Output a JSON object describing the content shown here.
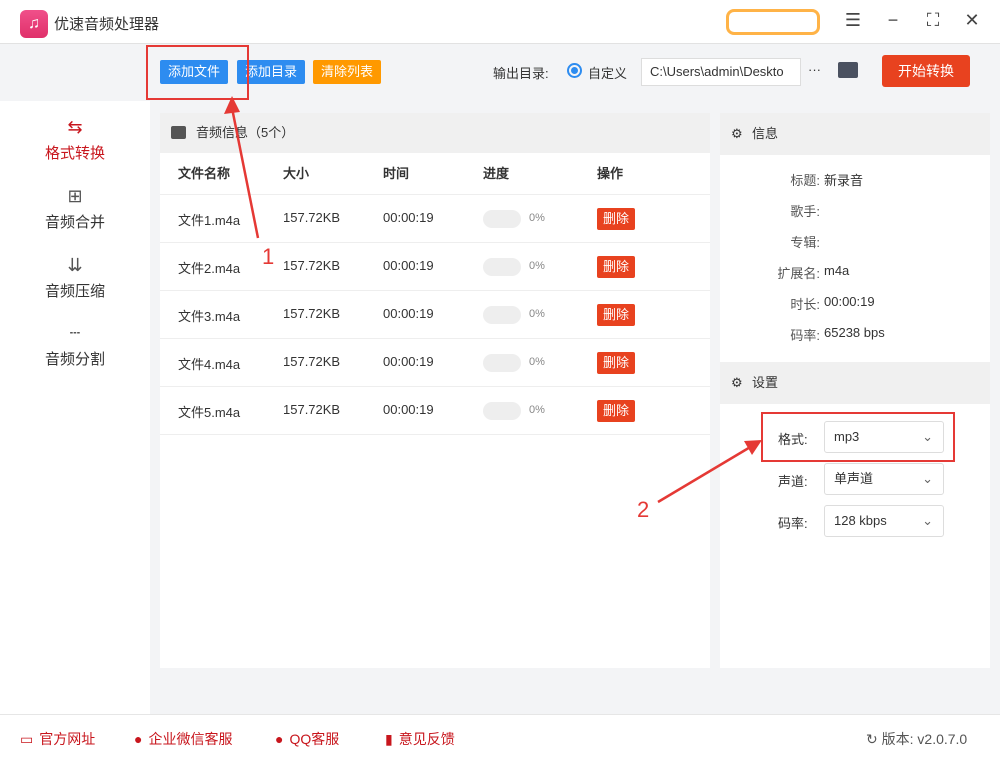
{
  "app": {
    "title": "优速音频处理器",
    "logo_icon": "headphones-icon"
  },
  "window": {
    "menu_icon": "☰",
    "min_icon": "−",
    "max_icon": "⛶",
    "close_icon": "✕"
  },
  "toolbar": {
    "add_file": "添加文件",
    "add_dir": "添加目录",
    "clear_list": "清除列表",
    "output_label": "输出目录:",
    "custom_label": "自定义",
    "output_path": "C:\\Users\\admin\\Deskto",
    "more": "···",
    "start": "开始转换"
  },
  "sidebar": {
    "items": [
      {
        "label": "格式转换",
        "icon": "⇆",
        "active": true
      },
      {
        "label": "音频合并",
        "icon": "⊞"
      },
      {
        "label": "音频压缩",
        "icon": "⇊"
      },
      {
        "label": "音频分割",
        "icon": "┄"
      }
    ]
  },
  "list": {
    "title": "音频信息（5个）",
    "columns": [
      "文件名称",
      "大小",
      "时间",
      "进度",
      "操作"
    ],
    "rows": [
      {
        "name": "文件1.m4a",
        "size": "157.72KB",
        "time": "00:00:19",
        "progress": "0%",
        "action": "删除"
      },
      {
        "name": "文件2.m4a",
        "size": "157.72KB",
        "time": "00:00:19",
        "progress": "0%",
        "action": "删除"
      },
      {
        "name": "文件3.m4a",
        "size": "157.72KB",
        "time": "00:00:19",
        "progress": "0%",
        "action": "删除"
      },
      {
        "name": "文件4.m4a",
        "size": "157.72KB",
        "time": "00:00:19",
        "progress": "0%",
        "action": "删除"
      },
      {
        "name": "文件5.m4a",
        "size": "157.72KB",
        "time": "00:00:19",
        "progress": "0%",
        "action": "删除"
      }
    ]
  },
  "info": {
    "title": "信息",
    "fields": [
      {
        "k": "标题:",
        "v": "新录音"
      },
      {
        "k": "歌手:",
        "v": ""
      },
      {
        "k": "专辑:",
        "v": ""
      },
      {
        "k": "扩展名:",
        "v": "m4a"
      },
      {
        "k": "时长:",
        "v": "00:00:19"
      },
      {
        "k": "码率:",
        "v": "65238 bps"
      }
    ]
  },
  "settings": {
    "title": "设置",
    "format_label": "格式:",
    "format": "mp3",
    "channel_label": "声道:",
    "channel": "单声道",
    "bitrate_label": "码率:",
    "bitrate": "128 kbps"
  },
  "footer": {
    "website": "官方网址",
    "wechat": "企业微信客服",
    "qq": "QQ客服",
    "feedback": "意见反馈",
    "version": "版本: v2.0.7.0"
  },
  "annotations": {
    "one": "1",
    "two": "2"
  }
}
